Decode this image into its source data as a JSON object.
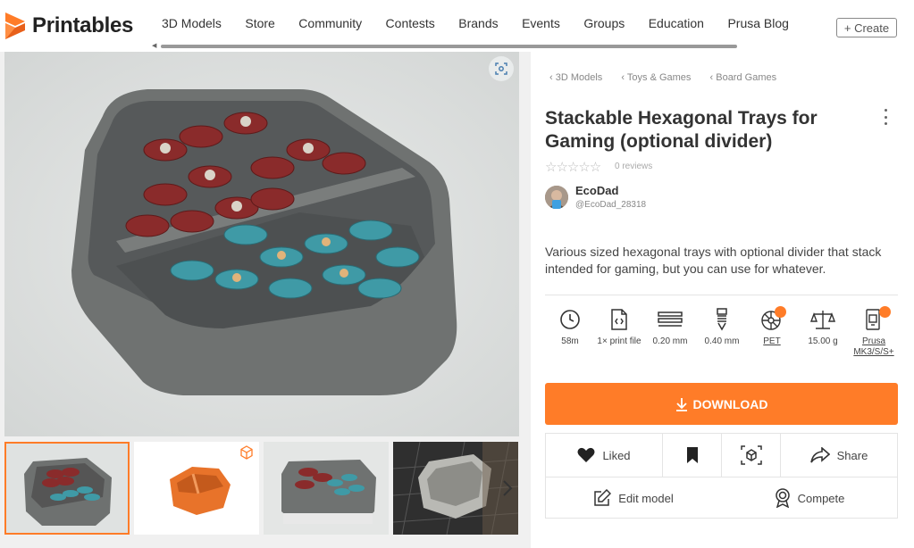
{
  "header": {
    "logo_text": "Printables",
    "nav": [
      "3D Models",
      "Store",
      "Community",
      "Contests",
      "Brands",
      "Events",
      "Groups",
      "Education",
      "Prusa Blog"
    ],
    "create_label": "+ Create"
  },
  "gallery": {
    "thumbnails": [
      "tray with red and teal tokens",
      "orange tray 3D preview",
      "tray with tokens on white",
      "silver tray on print bed"
    ]
  },
  "breadcrumbs": [
    "3D Models",
    "Toys & Games",
    "Board Games"
  ],
  "model": {
    "title": "Stackable Hexagonal Trays for Gaming (optional divider)",
    "rating_stars": "☆☆☆☆☆",
    "reviews": "0 reviews",
    "author_name": "EcoDad",
    "author_handle": "@EcoDad_28318",
    "description": "Various sized hexagonal trays with optional divider that stack intended for gaming, but you can use for whatever."
  },
  "params": [
    {
      "icon": "clock-icon",
      "label": "58m"
    },
    {
      "icon": "print-file-icon",
      "label": "1× print file"
    },
    {
      "icon": "layer-height-icon",
      "label": "0.20 mm"
    },
    {
      "icon": "nozzle-icon",
      "label": "0.40 mm"
    },
    {
      "icon": "filament-icon",
      "label": "PET"
    },
    {
      "icon": "scale-icon",
      "label": "15.00 g"
    },
    {
      "icon": "printer-icon",
      "label": "Prusa MK3/S/S+"
    }
  ],
  "actions": {
    "download": "DOWNLOAD",
    "liked": "Liked",
    "share": "Share",
    "edit": "Edit model",
    "compete": "Compete"
  },
  "colors": {
    "accent": "#ff7c28",
    "text": "#333333"
  }
}
